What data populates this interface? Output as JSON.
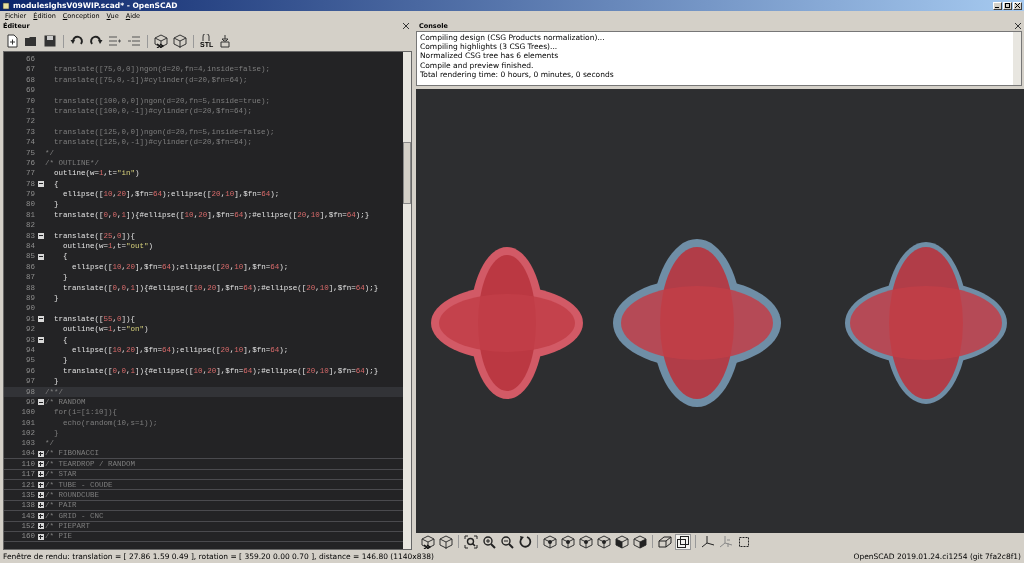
{
  "window": {
    "title": "moduleslghsV09WIP.scad* - OpenSCAD"
  },
  "menu": [
    {
      "label": "Fichier"
    },
    {
      "label": "Édition"
    },
    {
      "label": "Conception"
    },
    {
      "label": "Vue"
    },
    {
      "label": "Aide"
    }
  ],
  "editor": {
    "title": "Éditeur",
    "toolbar": [
      {
        "kind": "new"
      },
      {
        "kind": "open"
      },
      {
        "kind": "save"
      },
      {
        "kind": "separator"
      },
      {
        "kind": "undo"
      },
      {
        "kind": "redo"
      },
      {
        "kind": "indent"
      },
      {
        "kind": "unindent"
      },
      {
        "kind": "separator"
      },
      {
        "kind": "preview"
      },
      {
        "kind": "render"
      },
      {
        "kind": "separator"
      },
      {
        "kind": "export",
        "label": "STL"
      },
      {
        "kind": "print"
      }
    ],
    "lines": [
      {
        "number": "66",
        "current": false
      },
      {
        "number": "67",
        "text": "  translate([75,0,0])ngon(d=20,fn=4,inside=false);",
        "comment": true,
        "current": false
      },
      {
        "number": "68",
        "text": "  translate([75,0,-1])#cylinder(d=20,$fn=64);",
        "comment": true,
        "current": false
      },
      {
        "number": "69",
        "current": false
      },
      {
        "number": "70",
        "text": "  translate([100,0,0])ngon(d=20,fn=5,inside=true);",
        "comment": true,
        "current": false
      },
      {
        "number": "71",
        "text": "  translate([100,0,-1])#cylinder(d=20,$fn=64);",
        "comment": true,
        "current": false
      },
      {
        "number": "72",
        "current": false
      },
      {
        "number": "73",
        "text": "  translate([125,0,0])ngon(d=20,fn=5,inside=false);",
        "comment": true,
        "current": false
      },
      {
        "number": "74",
        "text": "  translate([125,0,-1])#cylinder(d=20,$fn=64);",
        "comment": true,
        "current": false
      },
      {
        "number": "75",
        "text": "*/",
        "comment": true,
        "current": false
      },
      {
        "number": "76",
        "text": "/* OUTLINE*/",
        "comment": true,
        "current": false
      },
      {
        "number": "77",
        "text": "  outline(w=1,t=\"in\")",
        "comment": false,
        "current": false
      },
      {
        "number": "78",
        "text": "  {",
        "comment": false,
        "current": false,
        "expanded": true
      },
      {
        "number": "79",
        "text": "    ellipse([10,20],$fn=64);ellipse([20,10],$fn=64);",
        "comment": false,
        "current": false
      },
      {
        "number": "80",
        "text": "  }",
        "comment": false,
        "current": false
      },
      {
        "number": "81",
        "text": "  translate([0,0,1]){#ellipse([10,20],$fn=64);#ellipse([20,10],$fn=64);}",
        "comment": false,
        "current": false
      },
      {
        "number": "82",
        "current": false
      },
      {
        "number": "83",
        "text": "  translate([25,0]){",
        "comment": false,
        "current": false,
        "expanded": true
      },
      {
        "number": "84",
        "text": "    outline(w=1,t=\"out\")",
        "comment": false,
        "current": false
      },
      {
        "number": "85",
        "text": "    {",
        "comment": false,
        "current": false,
        "expanded": true
      },
      {
        "number": "86",
        "text": "      ellipse([10,20],$fn=64);ellipse([20,10],$fn=64);",
        "comment": false,
        "current": false
      },
      {
        "number": "87",
        "text": "    }",
        "comment": false,
        "current": false
      },
      {
        "number": "88",
        "text": "    translate([0,0,1]){#ellipse([10,20],$fn=64);#ellipse([20,10],$fn=64);}",
        "comment": false,
        "current": false
      },
      {
        "number": "89",
        "text": "  }",
        "comment": false,
        "current": false
      },
      {
        "number": "90",
        "current": false
      },
      {
        "number": "91",
        "text": "  translate([55,0]){",
        "comment": false,
        "current": false,
        "expanded": true
      },
      {
        "number": "92",
        "text": "    outline(w=1,t=\"on\")",
        "comment": false,
        "current": false
      },
      {
        "number": "93",
        "text": "    {",
        "comment": false,
        "current": false,
        "expanded": true
      },
      {
        "number": "94",
        "text": "      ellipse([10,20],$fn=64);ellipse([20,10],$fn=64);",
        "comment": false,
        "current": false
      },
      {
        "number": "95",
        "text": "    }",
        "comment": false,
        "current": false
      },
      {
        "number": "96",
        "text": "    translate([0,0,1]){#ellipse([10,20],$fn=64);#ellipse([20,10],$fn=64);}",
        "comment": false,
        "current": false
      },
      {
        "number": "97",
        "text": "  }",
        "comment": false,
        "current": false
      },
      {
        "number": "98",
        "text": "/**/",
        "comment": true,
        "current": true
      },
      {
        "number": "99",
        "text": "/* RANDOM",
        "comment": true,
        "current": false,
        "expanded": true
      },
      {
        "number": "100",
        "text": "  for(i=[1:10]){",
        "comment": true,
        "current": false
      },
      {
        "number": "101",
        "text": "    echo(random(10,s=i));",
        "comment": true,
        "current": false
      },
      {
        "number": "102",
        "text": "  }",
        "comment": true,
        "current": false
      },
      {
        "number": "103",
        "text": "*/",
        "comment": true,
        "current": false
      },
      {
        "number": "104",
        "text": "/* FIBONACCI",
        "comment": true,
        "current": false,
        "expanded": false
      },
      {
        "number": "110",
        "text": "/* TEARDROP / RANDOM",
        "comment": true,
        "current": false,
        "expanded": false
      },
      {
        "number": "117",
        "text": "/* STAR",
        "comment": true,
        "current": false,
        "expanded": false
      },
      {
        "number": "121",
        "text": "/* TUBE - COUDE",
        "comment": true,
        "current": false,
        "expanded": false
      },
      {
        "number": "135",
        "text": "/* ROUNDCUBE",
        "comment": true,
        "current": false,
        "expanded": false
      },
      {
        "number": "138",
        "text": "/* PAIR",
        "comment": true,
        "current": false,
        "expanded": false
      },
      {
        "number": "143",
        "text": "/* GRID - CNC",
        "comment": true,
        "current": false,
        "expanded": false
      },
      {
        "number": "152",
        "text": "/* PIEPART",
        "comment": true,
        "current": false,
        "expanded": false
      },
      {
        "number": "160",
        "text": "/* PIE",
        "comment": true,
        "current": false,
        "expanded": false
      }
    ]
  },
  "console": {
    "title": "Console",
    "lines": [
      "Compiling design (CSG Products normalization)...",
      "Compiling highlights (3 CSG Trees)...",
      "Normalized CSG tree has 6 elements",
      "Compile and preview finished.",
      "Total rendering time: 0 hours, 0 minutes, 0 seconds"
    ]
  },
  "viewer_toolbar": [
    {
      "kind": "preview",
      "pressed": false
    },
    {
      "kind": "render",
      "pressed": false
    },
    {
      "kind": "separator"
    },
    {
      "kind": "view-all",
      "pressed": false
    },
    {
      "kind": "zoom-in",
      "pressed": false
    },
    {
      "kind": "zoom-out",
      "pressed": false
    },
    {
      "kind": "reset",
      "pressed": false
    },
    {
      "kind": "separator"
    },
    {
      "kind": "view-right",
      "pressed": false
    },
    {
      "kind": "view-top",
      "pressed": false
    },
    {
      "kind": "view-bottom",
      "pressed": false
    },
    {
      "kind": "view-left",
      "pressed": false
    },
    {
      "kind": "view-front",
      "pressed": false
    },
    {
      "kind": "view-back",
      "pressed": false
    },
    {
      "kind": "separator"
    },
    {
      "kind": "perspective",
      "pressed": false
    },
    {
      "kind": "orthogonal",
      "pressed": true
    },
    {
      "kind": "separator"
    },
    {
      "kind": "axes",
      "pressed": false
    },
    {
      "kind": "scale",
      "pressed": false
    },
    {
      "kind": "edges",
      "pressed": false
    }
  ],
  "status_bar": {
    "left": "Fenêtre de rendu: translation = [ 27.86 1.59 0.49 ], rotation = [ 359.20 0.00 0.70 ], distance = 146.80 (1140x838)",
    "right": "OpenSCAD 2019.01.24.ci1254 (git 7fa2c8f1)"
  }
}
